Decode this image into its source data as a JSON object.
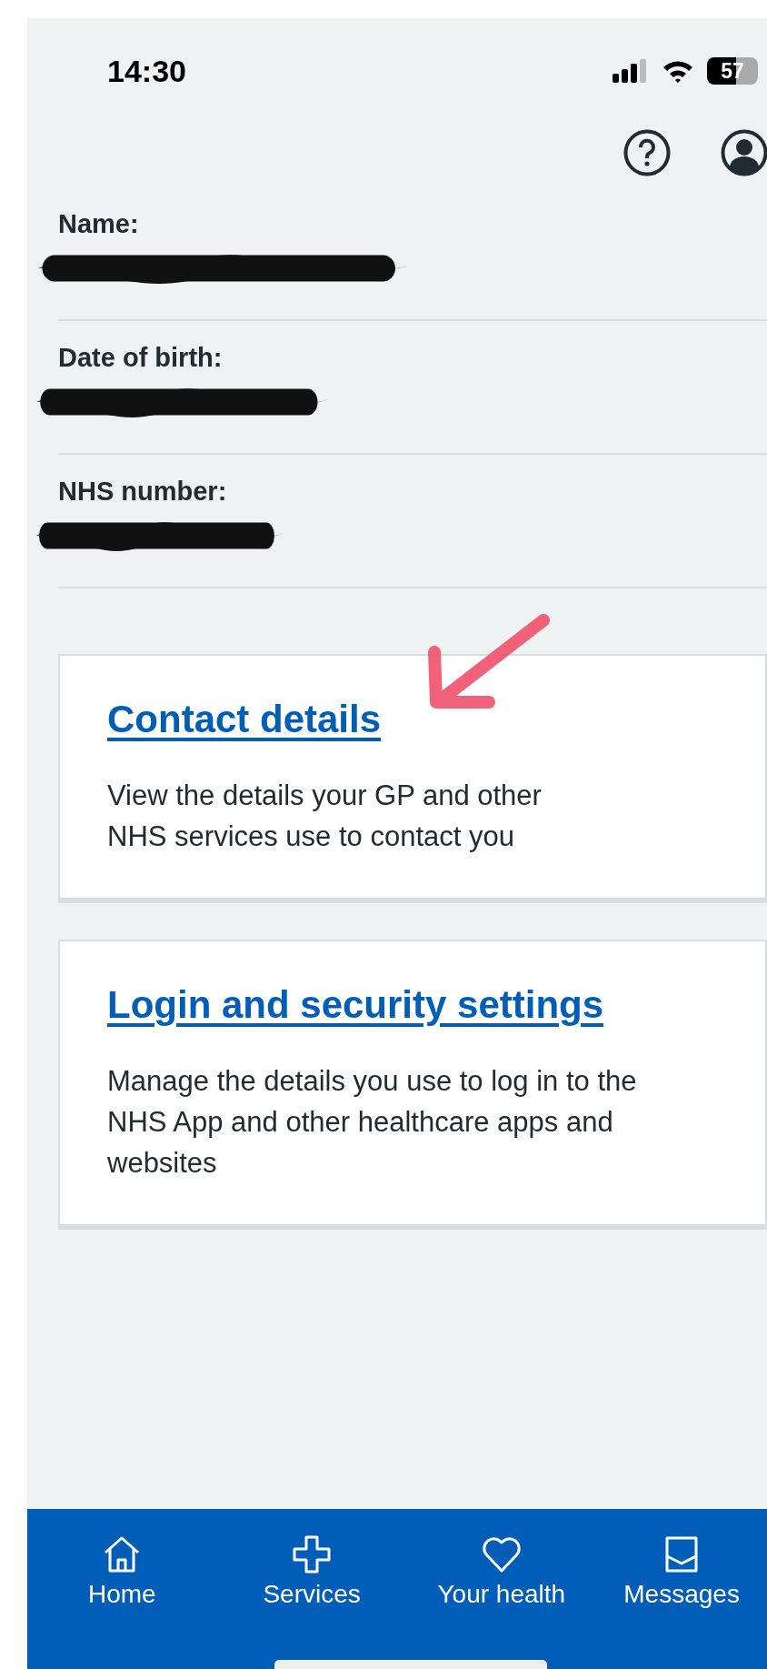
{
  "status_bar": {
    "time": "14:30",
    "battery": "57"
  },
  "fields": [
    {
      "label": "Name:"
    },
    {
      "label": "Date of birth:"
    },
    {
      "label": "NHS number:"
    }
  ],
  "cards": [
    {
      "title": "Contact details",
      "description": "View the details your GP and other NHS services use to contact you",
      "annotated": true
    },
    {
      "title": "Login and security settings",
      "description": "Manage the details you use to log in to the NHS App and other healthcare apps and websites",
      "annotated": false
    }
  ],
  "nav": [
    {
      "kind": "home",
      "label": "Home"
    },
    {
      "kind": "services",
      "label": "Services"
    },
    {
      "kind": "health",
      "label": "Your health"
    },
    {
      "kind": "messages",
      "label": "Messages"
    }
  ]
}
